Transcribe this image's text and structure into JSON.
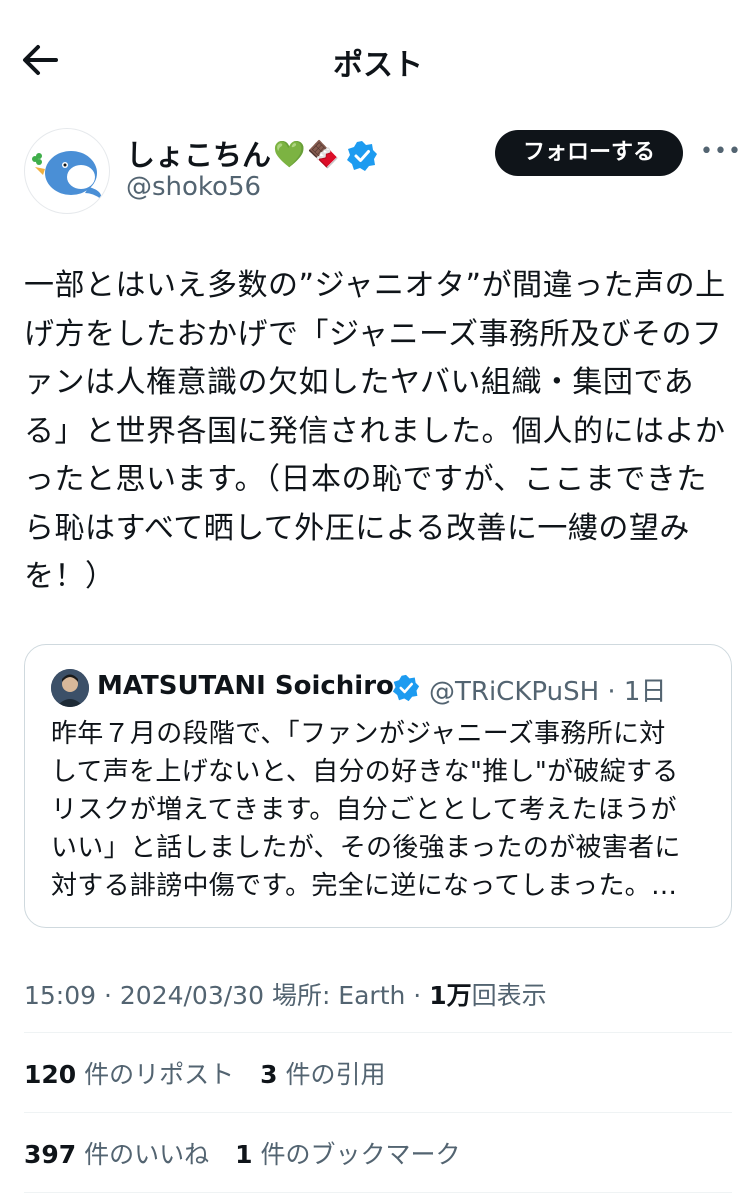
{
  "header": {
    "title": "ポスト",
    "back_icon": "arrow-left-icon"
  },
  "author": {
    "display_name": "しょこちん",
    "emojis": [
      "💚",
      "🍫"
    ],
    "handle": "@shoko56",
    "follow_label": "フォローする",
    "more_label": "•••"
  },
  "tweet": {
    "lines": [
      "一部とはいえ多数の”ジャニオタ”が間違った声の上",
      "げ方をしたおかげで「ジャニーズ事務所及びそのフ",
      "ァンは人権意識の欠如したヤバい組織・集団であ",
      "る」と世界各国に発信されました。個人的にはよか",
      "ったと思います。（日本の恥ですが、ここまできた",
      "ら恥はすべて晒して外圧による改善に一縷の望み",
      "を！）"
    ]
  },
  "quote": {
    "name": "MATSUTANI Soichiro",
    "handle_time": "@TRiCKPuSH · 1日",
    "lines": [
      "昨年７月の段階で、「ファンがジャニーズ事務所に対",
      "して声を上げないと、自分の好きな\"推し\"が破綻する",
      "リスクが増えてきます。自分ごととして考えたほうが",
      "いい」と話しましたが、その後強まったのが被害者に",
      "対する誹謗中傷です。完全に逆になってしまった。…"
    ]
  },
  "meta": {
    "time": "15:09",
    "date": "2024/03/30",
    "location": "場所: Earth",
    "views_num": "1万",
    "views_label": "回表示"
  },
  "stats": {
    "reposts_num": "120",
    "reposts_label": "件のリポスト",
    "quotes_num": "3",
    "quotes_label": "件の引用",
    "likes_num": "397",
    "likes_label": "件のいいね",
    "bookmarks_num": "1",
    "bookmarks_label": "件のブックマーク"
  },
  "colors": {
    "verified": "#1d9bf0",
    "text": "#0f1419",
    "muted": "#536471",
    "border": "#cfd9de"
  }
}
